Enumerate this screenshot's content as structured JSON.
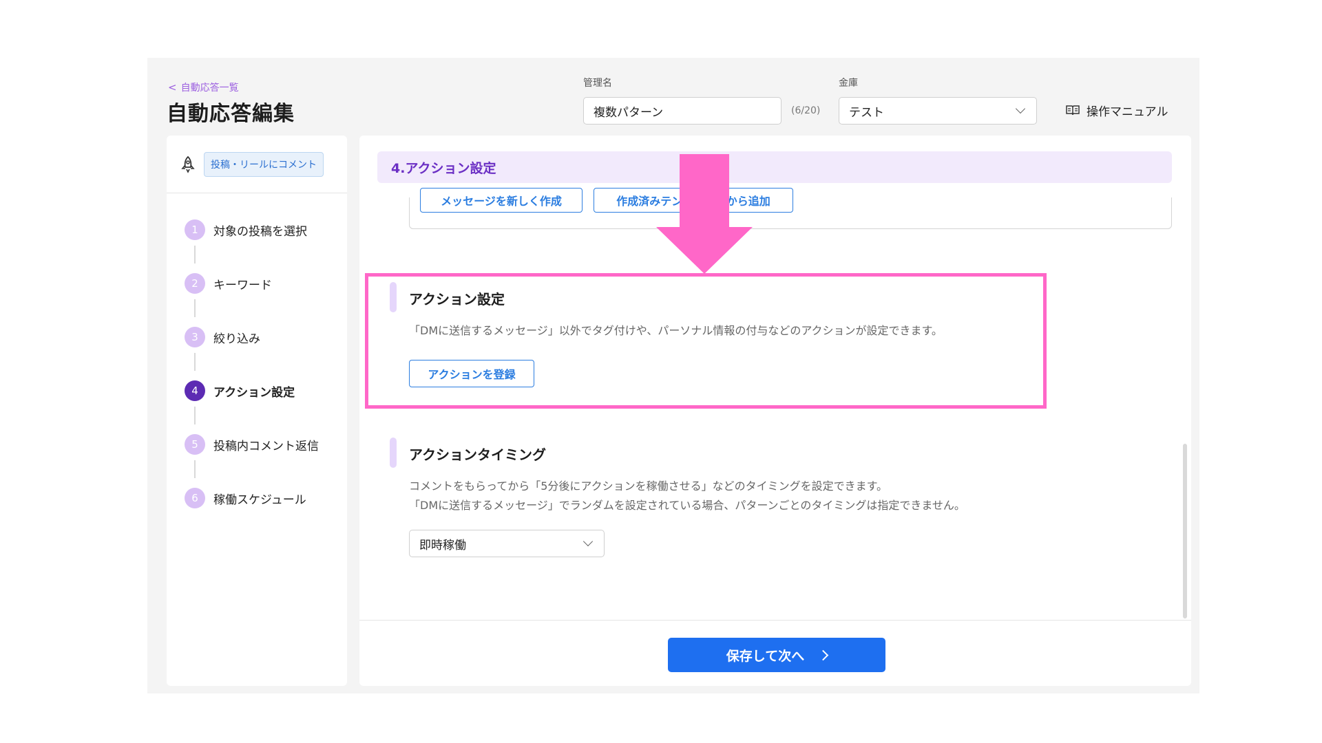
{
  "header": {
    "back_link": "自動応答一覧",
    "title": "自動応答編集",
    "name_label": "管理名",
    "name_value": "複数パターン",
    "name_counter": "(6/20)",
    "vault_label": "金庫",
    "vault_value": "テスト",
    "manual_label": "操作マニュアル"
  },
  "sidebar": {
    "badge": "投稿・リールにコメント",
    "steps": [
      {
        "num": "1",
        "label": "対象の投稿を選択"
      },
      {
        "num": "2",
        "label": "キーワード"
      },
      {
        "num": "3",
        "label": "絞り込み"
      },
      {
        "num": "4",
        "label": "アクション設定"
      },
      {
        "num": "5",
        "label": "投稿内コメント返信"
      },
      {
        "num": "6",
        "label": "稼働スケジュール"
      }
    ],
    "active_step": 4
  },
  "main": {
    "section_title": "4.アクション設定",
    "prev_buttons": {
      "new_message": "メッセージを新しく作成",
      "from_template": "作成済みテンプレートから追加"
    },
    "action_block": {
      "title": "アクション設定",
      "description": "「DMに送信するメッセージ」以外でタグ付けや、パーソナル情報の付与などのアクションが設定できます。",
      "button": "アクションを登録"
    },
    "timing_block": {
      "title": "アクションタイミング",
      "description_line1": "コメントをもらってから「5分後にアクションを稼働させる」などのタイミングを設定できます。",
      "description_line2": "「DMに送信するメッセージ」でランダムを設定されている場合、パターンごとのタイミングは指定できません。",
      "select_value": "即時稼働"
    },
    "save_button": "保存して次へ"
  },
  "colors": {
    "accent_purple": "#6b2fc4",
    "primary_blue": "#1e6ff0",
    "annotation_pink": "#ff67c8"
  }
}
